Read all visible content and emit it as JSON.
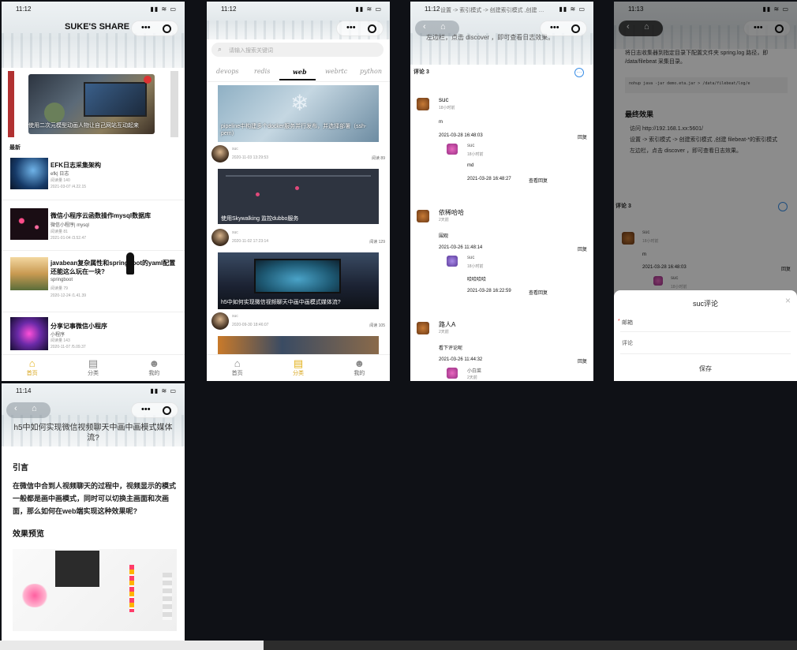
{
  "p1": {
    "time": "11:12",
    "signal": "▮▮ ≋ ▭",
    "title": "SUKE'S SHARE",
    "banner_caption": "使用二次元模型动画人物让自己网站互动起来",
    "section_label": "最新",
    "articles": [
      {
        "title": "EFK日志采集架构",
        "tags": "efk| 日志",
        "meta": "阅读量 140",
        "date": "2021-03-07 /4.22.15"
      },
      {
        "title": "微信小程序云函数操作mysql数据库",
        "tags": "微信小程序| mysql",
        "meta": "阅读量 81",
        "date": "2021-01-04 /3.52.47"
      },
      {
        "title": "javabean复杂属性和springboot的yaml配置还能这么玩在一块?",
        "tags": "springboot",
        "meta": "阅读量 79",
        "date": "2020-12-24 /1.41.39"
      },
      {
        "title": "分享记事微信小程序",
        "tags": "小程序",
        "meta": "阅读量 143",
        "date": "2020-11-07 /5.09.37"
      }
    ],
    "tabs": [
      "首页",
      "分类",
      "我的"
    ]
  },
  "p2": {
    "time": "11:12",
    "search_placeholder": "请输入搜索关键词",
    "categories": [
      "devops",
      "redis",
      "web",
      "webrtc",
      "python"
    ],
    "posts": [
      {
        "caption": "pipeline中构建多个docker服务并行发布，并选择部署（ssh-pem）",
        "user": "suc",
        "date": "2020-11-03 13:29:53",
        "views": "阅读 89"
      },
      {
        "caption": "使用Skywalking 监控dubbo服务",
        "user": "suc",
        "date": "2020-11-02 17:23:14",
        "views": "阅读 129"
      },
      {
        "caption": "h5中如何实现微信视频聊天中画中画模式媒体流?",
        "user": "suc",
        "date": "2020-09-30 18:46:07",
        "views": "阅读 105"
      }
    ],
    "tabs": [
      "首页",
      "分类",
      "我的"
    ]
  },
  "p3": {
    "time": "11:12",
    "crumb": "设置 -> 索引模式 -> 创建索引模式 ,创建 …",
    "crumb2": "左边栏，点击 discover ，即可查看日志效果。",
    "comment_label": "评论 3",
    "comments": [
      {
        "name": "suc",
        "ago": "18小时前",
        "text": "m",
        "date": "2021-03-28 16:48:03",
        "reply_label": "回复",
        "reply": {
          "name": "suc",
          "ago": "18小时前",
          "text": "md",
          "date": "2021-03-28 16:48:27",
          "action": "查看回复"
        }
      },
      {
        "name": "依稀哈哈",
        "ago": "2天前",
        "text": "围观",
        "date": "2021-03-26 11:48:14",
        "reply_label": "回复",
        "reply": {
          "name": "suc",
          "ago": "18小时前",
          "text": "哈哈哈哈",
          "date": "2021-03-28 16:22:59",
          "action": "查看回复"
        }
      },
      {
        "name": "路人A",
        "ago": "2天前",
        "text": "看下评论呢",
        "date": "2021-03-26 11:44:32",
        "reply_label": "回复",
        "reply": {
          "name": "小白菜",
          "ago": "2天前"
        }
      }
    ]
  },
  "p4": {
    "time": "11:13",
    "log_text": "将日志收集器到指定目录下配置文件夹 spring.log 路径，即 /data/filebeat 采集目录。",
    "cmd": "nohup java -jar demo.eta.jar > /data/filebeat/log/e",
    "effect_title": "最终效果",
    "bullets": [
      "访问 http://192.168.1.xx:5601/",
      "设置 -> 索引模式 -> 创建索引模式 ,创建 filebeat-*的索引模式",
      "左边栏，点击 discover ，即可查看日志效果。"
    ],
    "comment_label": "评论 3",
    "c_name": "suc",
    "c_ago": "18小时前",
    "c_text": "m",
    "c_date": "2021-03-28 16:48:03",
    "c_reply": "回复",
    "c2_name": "suc",
    "c2_ago": "18小时前",
    "modal_title": "suc评论",
    "email_label": "邮箱",
    "comment_field": "评论",
    "save": "保存"
  },
  "p5": {
    "time": "11:14",
    "title": "h5中如何实现微信视频聊天中画中画模式媒体流?",
    "intro_heading": "引言",
    "intro_text": "在微信中合到人视频聊天的过程中，视频显示的模式一般都是画中画模式，同时可以切换主画面和次画面，那么如何在web端实现这种效果呢?",
    "preview_heading": "效果预览"
  }
}
